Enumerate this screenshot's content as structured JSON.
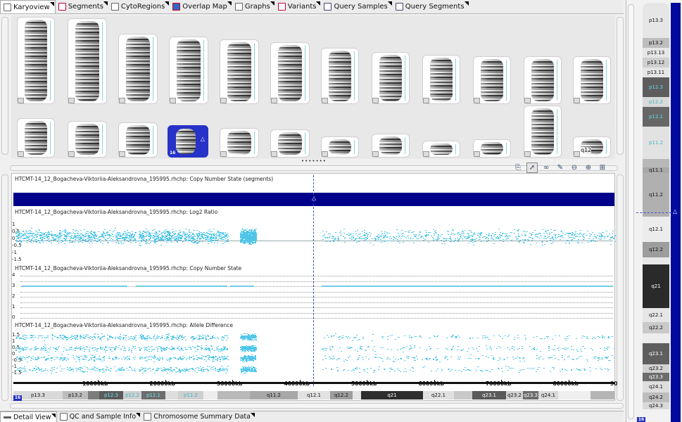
{
  "top_tabs": [
    {
      "label": "Karyoview",
      "icon": "karyoview-icon",
      "active": true
    },
    {
      "label": "Segments",
      "icon": "segments-icon",
      "active": false
    },
    {
      "label": "CytoRegions",
      "icon": "cytoregions-icon",
      "active": false
    },
    {
      "label": "Overlap Map",
      "icon": "overlap-map-icon",
      "active": false
    },
    {
      "label": "Graphs",
      "icon": "graphs-icon",
      "active": false
    },
    {
      "label": "Variants",
      "icon": "variants-icon",
      "active": false
    },
    {
      "label": "Query Samples",
      "icon": "query-samples-icon",
      "active": false
    },
    {
      "label": "Query Segments",
      "icon": "query-segments-icon",
      "active": false
    }
  ],
  "karyoview": {
    "selected_chromosome": "16",
    "selected_marker": "△",
    "chr23_label": "q12"
  },
  "tracks": {
    "cn_segments_title": "HTCMT-14_12_Bogacheva-Viktoriia-Aleksandrovna_195995.rhchp: Copy Number State (segments)",
    "log2_title": "HTCMT-14_12_Bogacheva-Viktoriia-Aleksandrovna_195995.rhchp: Log2 Ratio",
    "cn_state_title": "HTCMT-14_12_Bogacheva-Viktoriia-Aleksandrovna_195995.rhchp: Copy Number State",
    "allele_title": "HTCMT-14_12_Bogacheva-Viktoriia-Aleksandrovna_195995.rhchp: Allele Difference",
    "cursor_marker": "△",
    "log2_ylabels": [
      "1",
      "0.5",
      "0",
      "-0.5",
      "-1",
      "-1.5"
    ],
    "cn_ylabels": [
      "4",
      "3",
      "2",
      "1",
      "0"
    ],
    "allele_ylabels": [
      "1.5",
      "1",
      "0.5",
      "0",
      "-0.5",
      "-1",
      "-1.5"
    ],
    "axis_labels": [
      "10000kb",
      "20000kb",
      "30000kb",
      "40000kb",
      "50000kb",
      "60000kb",
      "70000kb",
      "80000kb",
      "90"
    ],
    "chromosome_badge": "16"
  },
  "ideogram_bands": [
    {
      "name": "p13.3",
      "width": 70,
      "bg": "#d9d9d9",
      "fg": "#111"
    },
    {
      "name": "p13.2",
      "width": 36,
      "bg": "#bdbdbd",
      "fg": "#111"
    },
    {
      "name": "",
      "width": 16,
      "bg": "#7d7d7d",
      "fg": "#111"
    },
    {
      "name": "p12.3",
      "width": 34,
      "bg": "#5b5b5b",
      "fg": "#6fe0ef"
    },
    {
      "name": "p12.2",
      "width": 26,
      "bg": "#cfcfcf",
      "fg": "#3fb8c8"
    },
    {
      "name": "p12.1",
      "width": 34,
      "bg": "#6d6d6d",
      "fg": "#6fe0ef"
    },
    {
      "name": "",
      "width": 18,
      "bg": "#dedede",
      "fg": "#111"
    },
    {
      "name": "p11.2",
      "width": 36,
      "bg": "#cfcfcf",
      "fg": "#3fb8c8"
    },
    {
      "name": "",
      "width": 20,
      "bg": "#ededed",
      "fg": "#111"
    },
    {
      "name": "",
      "width": 46,
      "bg": "#b9b9b9",
      "fg": "#111"
    },
    {
      "name": "q11.2",
      "width": 68,
      "bg": "#a8a8a8",
      "fg": "#111"
    },
    {
      "name": "q12.1",
      "width": 46,
      "bg": "#e2e2e2",
      "fg": "#111"
    },
    {
      "name": "q12.2",
      "width": 32,
      "bg": "#9d9d9d",
      "fg": "#111"
    },
    {
      "name": "",
      "width": 12,
      "bg": "#e5e5e5",
      "fg": "#111"
    },
    {
      "name": "q21",
      "width": 88,
      "bg": "#2e2e2e",
      "fg": "#fff"
    },
    {
      "name": "q22.1",
      "width": 44,
      "bg": "#e0e0e0",
      "fg": "#111"
    },
    {
      "name": "",
      "width": 26,
      "bg": "#c9c9c9",
      "fg": "#111"
    },
    {
      "name": "q23.1",
      "width": 48,
      "bg": "#5a5a5a",
      "fg": "#fff"
    },
    {
      "name": "q23.2",
      "width": 24,
      "bg": "#d2d2d2",
      "fg": "#111"
    },
    {
      "name": "q23.3",
      "width": 22,
      "bg": "#6d6d6d",
      "fg": "#fff"
    },
    {
      "name": "q24.1",
      "width": 28,
      "bg": "#d9d9d9",
      "fg": "#111"
    },
    {
      "name": "",
      "width": 46,
      "bg": "#efefef",
      "fg": "#111"
    },
    {
      "name": "",
      "width": 34,
      "bg": "#b5b5b5",
      "fg": "#111"
    }
  ],
  "right_panel": {
    "marker": "△",
    "badge": "16",
    "bands": [
      {
        "name": "p13.3",
        "h": 50,
        "bg": "#e6e6e6",
        "fg": "#111"
      },
      {
        "name": "p13.2",
        "h": 14,
        "bg": "#bdbdbd",
        "fg": "#111"
      },
      {
        "name": "p13.13",
        "h": 14,
        "bg": "#e6e6e6",
        "fg": "#111"
      },
      {
        "name": "p13.12",
        "h": 14,
        "bg": "#cfcfcf",
        "fg": "#111"
      },
      {
        "name": "p13.11",
        "h": 14,
        "bg": "#e6e6e6",
        "fg": "#111"
      },
      {
        "name": "p12.3",
        "h": 28,
        "bg": "#5d5d5d",
        "fg": "#5fd8ea"
      },
      {
        "name": "p12.2",
        "h": 14,
        "bg": "#d9d9d9",
        "fg": "#3fb8c8"
      },
      {
        "name": "p12.1",
        "h": 28,
        "bg": "#676767",
        "fg": "#5fd8ea"
      },
      {
        "name": "p11.2",
        "h": 46,
        "bg": "#e2e2e2",
        "fg": "#3fb8c8"
      },
      {
        "name": "",
        "h": 12,
        "bg": "#b8b8b8",
        "fg": "#111"
      },
      {
        "name": "q11.1",
        "h": 8,
        "bg": "#a9a9a9",
        "fg": "#111"
      },
      {
        "name": "q11.2",
        "h": 62,
        "bg": "#b0b0b0",
        "fg": "#111"
      },
      {
        "name": "q12.1",
        "h": 36,
        "bg": "#ececec",
        "fg": "#111"
      },
      {
        "name": "q12.2",
        "h": 22,
        "bg": "#9d9d9d",
        "fg": "#111"
      },
      {
        "name": "",
        "h": 10,
        "bg": "#e8e8e8",
        "fg": "#111"
      },
      {
        "name": "q21",
        "h": 62,
        "bg": "#2a2a2a",
        "fg": "#fff"
      },
      {
        "name": "q22.1",
        "h": 20,
        "bg": "#e6e6e6",
        "fg": "#111"
      },
      {
        "name": "q22.2",
        "h": 16,
        "bg": "#c9c9c9",
        "fg": "#111"
      },
      {
        "name": "",
        "h": 14,
        "bg": "#ededed",
        "fg": "#111"
      },
      {
        "name": "q23.1",
        "h": 30,
        "bg": "#5e5e5e",
        "fg": "#fff"
      },
      {
        "name": "q23.2",
        "h": 12,
        "bg": "#d2d2d2",
        "fg": "#111"
      },
      {
        "name": "q23.3",
        "h": 12,
        "bg": "#6b6b6b",
        "fg": "#fff"
      },
      {
        "name": "q24.1",
        "h": 16,
        "bg": "#dedede",
        "fg": "#111"
      },
      {
        "name": "q24.2",
        "h": 14,
        "bg": "#bdbdbd",
        "fg": "#111"
      },
      {
        "name": "q24.3",
        "h": 10,
        "bg": "#d9d9d9",
        "fg": "#111"
      }
    ]
  },
  "bottom_tabs": [
    {
      "label": "Detail View",
      "icon": "detail-view-icon",
      "active": true
    },
    {
      "label": "QC and Sample Info",
      "icon": "qc-sample-info-icon",
      "active": false
    },
    {
      "label": "Chromosome Summary Data",
      "icon": "chromosome-summary-icon",
      "active": false
    }
  ],
  "colors": {
    "data_point": "#4fc6e8",
    "segment_bar": "#00008b",
    "selection": "#2732c8"
  }
}
